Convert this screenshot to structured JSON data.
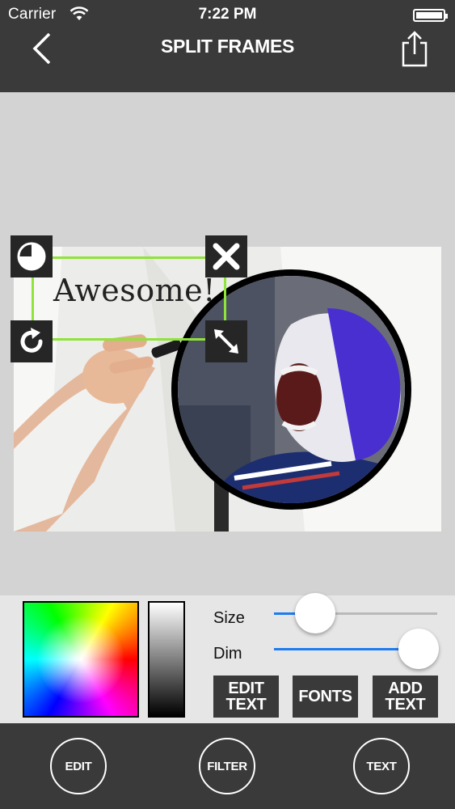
{
  "status_bar": {
    "carrier": "Carrier",
    "time": "7:22 PM"
  },
  "nav": {
    "title": "SPLIT FRAMES",
    "back_icon": "chevron-left-icon",
    "share_icon": "share-icon"
  },
  "canvas": {
    "overlay_text": "Awesome!",
    "handles": {
      "top_left": "pie-icon",
      "top_right": "close-icon",
      "bottom_left": "rotate-icon",
      "bottom_right": "resize-icon"
    },
    "text_box_border_color": "#8fe33a"
  },
  "editor": {
    "size_label": "Size",
    "dim_label": "Dim",
    "size_value": 0.25,
    "dim_value": 0.9,
    "slider_accent": "#1e7bf0",
    "buttons": {
      "edit_text": "EDIT\nTEXT",
      "fonts": "FONTS",
      "add_text": "ADD\nTEXT"
    }
  },
  "tabbar": {
    "edit": "EDIT",
    "filter": "FILTER",
    "text": "TEXT"
  },
  "colors": {
    "bar_bg": "#3a3a3a",
    "canvas_bg": "#d3d3d3",
    "panel_bg": "#e6e6e6"
  }
}
